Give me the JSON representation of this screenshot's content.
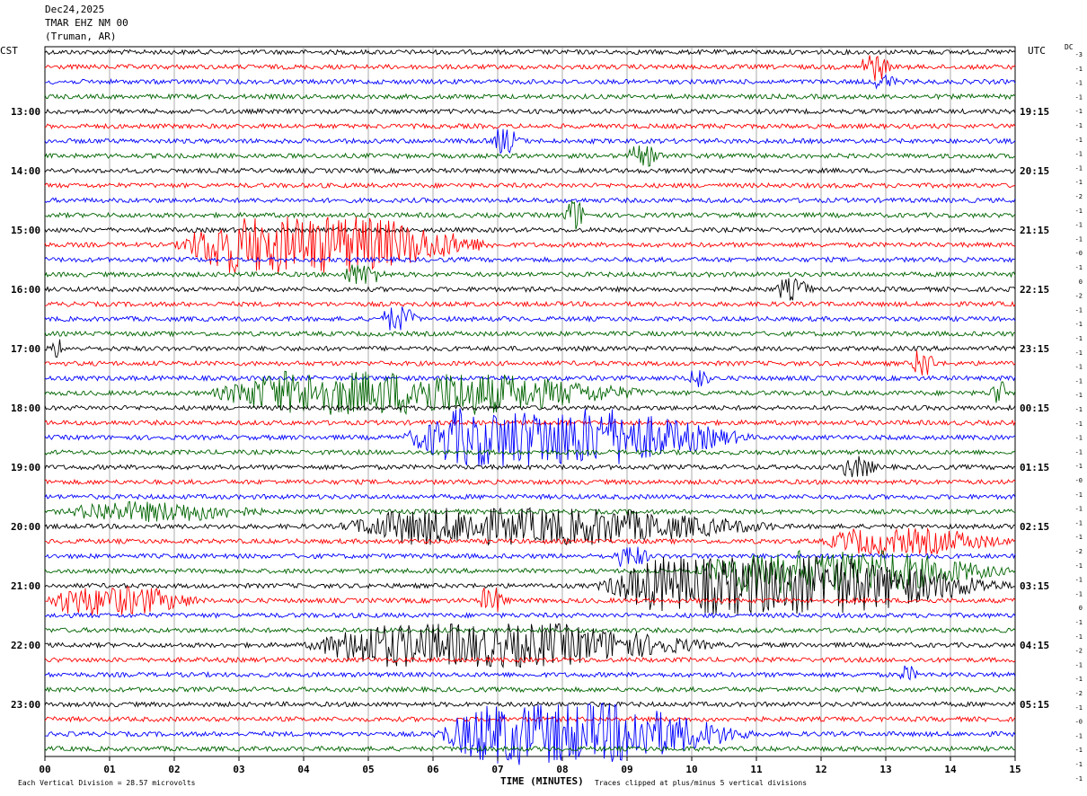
{
  "header": {
    "date": "Dec24,2025",
    "station": "TMAR EHZ NM 00",
    "location": "(Truman, AR)",
    "left_zone": "CST",
    "right_zone": "UTC",
    "dc_label": "DC"
  },
  "footer": {
    "scale_note": "Each Vertical Division =   28.57 microvolts",
    "clip_note": "Traces clipped at plus/minus 5 vertical divisions",
    "x_title": "TIME (MINUTES)"
  },
  "chart_data": {
    "type": "line",
    "title": "Dec24,2025 TMAR EHZ NM 00 (Truman, AR)",
    "xlabel": "TIME (MINUTES)",
    "ylabel": "",
    "xlim": [
      0,
      15
    ],
    "x_ticks": [
      "00",
      "01",
      "02",
      "03",
      "04",
      "05",
      "06",
      "07",
      "08",
      "09",
      "10",
      "11",
      "12",
      "13",
      "14",
      "15"
    ],
    "trace_colors": [
      "#000000",
      "#ff0000",
      "#0000ff",
      "#006400"
    ],
    "num_traces": 48,
    "minutes_per_trace": 15,
    "left_hour_labels": [
      {
        "trace": 4,
        "label": "13:00"
      },
      {
        "trace": 8,
        "label": "14:00"
      },
      {
        "trace": 12,
        "label": "15:00"
      },
      {
        "trace": 16,
        "label": "16:00"
      },
      {
        "trace": 20,
        "label": "17:00"
      },
      {
        "trace": 24,
        "label": "18:00"
      },
      {
        "trace": 28,
        "label": "19:00"
      },
      {
        "trace": 32,
        "label": "20:00"
      },
      {
        "trace": 36,
        "label": "21:00"
      },
      {
        "trace": 40,
        "label": "22:00"
      },
      {
        "trace": 44,
        "label": "23:00"
      }
    ],
    "right_hour_labels": [
      {
        "trace": 4,
        "label": "19:15"
      },
      {
        "trace": 8,
        "label": "20:15"
      },
      {
        "trace": 12,
        "label": "21:15"
      },
      {
        "trace": 16,
        "label": "22:15"
      },
      {
        "trace": 20,
        "label": "23:15"
      },
      {
        "trace": 24,
        "label": "00:15"
      },
      {
        "trace": 28,
        "label": "01:15"
      },
      {
        "trace": 32,
        "label": "02:15"
      },
      {
        "trace": 36,
        "label": "03:15"
      },
      {
        "trace": 40,
        "label": "04:15"
      },
      {
        "trace": 44,
        "label": "05:15"
      }
    ],
    "dc_offsets": [
      "-3",
      "-1",
      "-1",
      "-1",
      "-1",
      "-1",
      "-1",
      "-1",
      "-1",
      "-1",
      "-2",
      "-1",
      "-1",
      "-1",
      "-0",
      "-1",
      "0",
      "-2",
      "-1",
      "-1",
      "-1",
      "-1",
      "-1",
      "-1",
      "-1",
      "-1",
      "-1",
      "-1",
      "-1",
      "-1",
      "-0",
      "-1",
      "-1",
      "-1",
      "-1",
      "-2",
      "-1",
      "-1",
      "-1",
      "0",
      "-1",
      "-1",
      "-2",
      "-1",
      "-1",
      "-2",
      "-1",
      "-0",
      "-1",
      "-1",
      "-1",
      "-1"
    ],
    "events": [
      {
        "trace": 1,
        "start": 12.6,
        "end": 13.1,
        "amp": 14
      },
      {
        "trace": 2,
        "start": 12.8,
        "end": 13.2,
        "amp": 7
      },
      {
        "trace": 6,
        "start": 6.9,
        "end": 7.4,
        "amp": 12
      },
      {
        "trace": 7,
        "start": 9.0,
        "end": 9.6,
        "amp": 9
      },
      {
        "trace": 11,
        "start": 8.0,
        "end": 8.4,
        "amp": 16
      },
      {
        "trace": 13,
        "start": 2.0,
        "end": 7.0,
        "amp": 30
      },
      {
        "trace": 15,
        "start": 4.6,
        "end": 5.3,
        "amp": 10
      },
      {
        "trace": 16,
        "start": 11.3,
        "end": 11.9,
        "amp": 10
      },
      {
        "trace": 18,
        "start": 5.2,
        "end": 5.8,
        "amp": 12
      },
      {
        "trace": 20,
        "start": 0.1,
        "end": 0.3,
        "amp": 12
      },
      {
        "trace": 21,
        "start": 13.4,
        "end": 13.8,
        "amp": 14
      },
      {
        "trace": 22,
        "start": 9.9,
        "end": 10.3,
        "amp": 10
      },
      {
        "trace": 23,
        "start": 2.5,
        "end": 9.5,
        "amp": 22
      },
      {
        "trace": 23,
        "start": 14.6,
        "end": 14.9,
        "amp": 14
      },
      {
        "trace": 26,
        "start": 5.5,
        "end": 11.0,
        "amp": 30
      },
      {
        "trace": 28,
        "start": 12.3,
        "end": 12.9,
        "amp": 10
      },
      {
        "trace": 31,
        "start": 0.3,
        "end": 3.5,
        "amp": 9
      },
      {
        "trace": 32,
        "start": 4.5,
        "end": 11.5,
        "amp": 18
      },
      {
        "trace": 33,
        "start": 12.0,
        "end": 15.0,
        "amp": 12
      },
      {
        "trace": 34,
        "start": 8.8,
        "end": 9.4,
        "amp": 10
      },
      {
        "trace": 35,
        "start": 10.0,
        "end": 15.0,
        "amp": 22
      },
      {
        "trace": 36,
        "start": 8.5,
        "end": 15.0,
        "amp": 30
      },
      {
        "trace": 37,
        "start": 0.0,
        "end": 2.5,
        "amp": 14
      },
      {
        "trace": 37,
        "start": 6.7,
        "end": 7.2,
        "amp": 12
      },
      {
        "trace": 40,
        "start": 4.0,
        "end": 10.5,
        "amp": 22
      },
      {
        "trace": 42,
        "start": 13.2,
        "end": 13.5,
        "amp": 8
      },
      {
        "trace": 46,
        "start": 6.0,
        "end": 11.0,
        "amp": 32
      }
    ]
  }
}
